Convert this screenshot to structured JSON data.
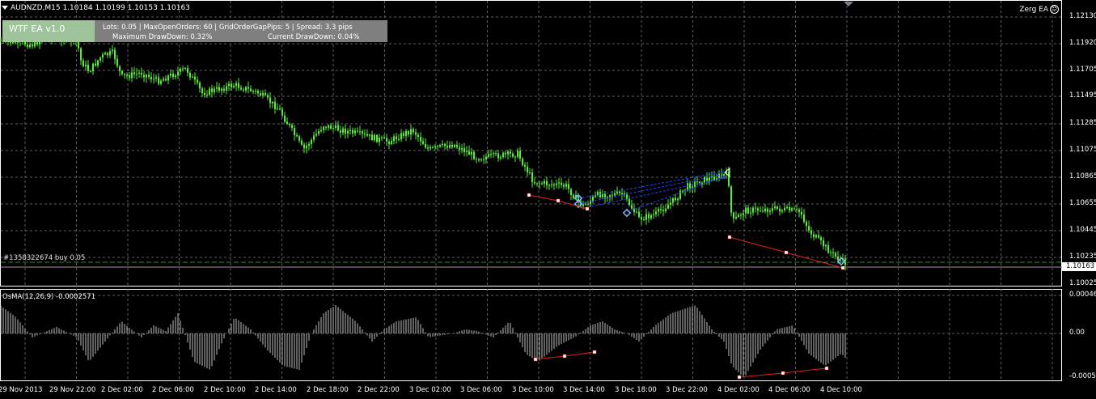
{
  "symbol_header": "AUDNZD,M15  1.10184 1.10199 1.10153 1.10163",
  "ea_name": "Zerg EA",
  "ea_icon": "smiley-icon",
  "panel": {
    "title": "WTF EA v1.0",
    "row1": "Lots: 0.05    |    MaxOpenOrders: 60    |    GridOrderGapPips: 5    |    Spread: 3.3 pips",
    "max_drawdown": "Maximum DrawDown: 0.32%",
    "current_drawdown": "Current DrawDown: 0.04%"
  },
  "order_label": "#1358322674 buy 0.05",
  "current_price_tag": "1.10163",
  "indicator_label": "OsMA(12,26,9) -0.0002571",
  "price_axis": [
    "1.12130",
    "1.11920",
    "1.11705",
    "1.11495",
    "1.11285",
    "1.11075",
    "1.10865",
    "1.10655",
    "1.10445",
    "1.10235",
    "1.10025"
  ],
  "osma_axis": [
    "0.000465",
    "0.00",
    "-0.00050"
  ],
  "time_axis": [
    "29 Nov 2013",
    "29 Nov 22:00",
    "2 Dec 02:00",
    "2 Dec 06:00",
    "2 Dec 10:00",
    "2 Dec 14:00",
    "2 Dec 18:00",
    "2 Dec 22:00",
    "3 Dec 02:00",
    "3 Dec 06:00",
    "3 Dec 10:00",
    "3 Dec 14:00",
    "3 Dec 18:00",
    "3 Dec 22:00",
    "4 Dec 02:00",
    "4 Dec 06:00",
    "4 Dec 10:00"
  ],
  "colors": {
    "background": "#000000",
    "candles": "#55ee33",
    "grid": "#606060",
    "histogram": "#c0c0c0",
    "divergence_line": "#e02020",
    "order_line": "#2a8a2a",
    "panel_bg": "#7f7f7f",
    "panel_title_bg": "#9fc39a"
  },
  "chart_data": {
    "type": "line",
    "title": "AUDNZD,M15",
    "series": [
      {
        "name": "AUDNZD",
        "x": [
          "29 Nov 2013",
          "29 Nov 22:00",
          "2 Dec 02:00",
          "2 Dec 06:00",
          "2 Dec 10:00",
          "2 Dec 14:00",
          "2 Dec 18:00",
          "2 Dec 22:00",
          "3 Dec 02:00",
          "3 Dec 06:00",
          "3 Dec 10:00",
          "3 Dec 14:00",
          "3 Dec 18:00",
          "3 Dec 22:00",
          "4 Dec 02:00",
          "4 Dec 06:00",
          "4 Dec 10:00"
        ],
        "values": [
          1.1194,
          1.1196,
          1.1178,
          1.1172,
          1.1158,
          1.1145,
          1.1123,
          1.112,
          1.1117,
          1.1108,
          1.1082,
          1.1072,
          1.106,
          1.109,
          1.106,
          1.1065,
          1.1016
        ]
      },
      {
        "name": "OsMA(12,26,9)",
        "x": [
          "29 Nov 2013",
          "29 Nov 22:00",
          "2 Dec 02:00",
          "2 Dec 06:00",
          "2 Dec 10:00",
          "2 Dec 14:00",
          "2 Dec 18:00",
          "2 Dec 22:00",
          "3 Dec 02:00",
          "3 Dec 06:00",
          "3 Dec 10:00",
          "3 Dec 14:00",
          "3 Dec 18:00",
          "3 Dec 22:00",
          "4 Dec 02:00",
          "4 Dec 06:00",
          "4 Dec 10:00"
        ],
        "values": [
          0.00035,
          8e-05,
          -0.0003,
          0.0001,
          -0.0003,
          0.0002,
          -0.00035,
          0.00015,
          -0.0002,
          0.0002,
          -0.00025,
          0.00015,
          -0.0002,
          0.00035,
          -0.0005,
          0.0001,
          -0.00026
        ]
      }
    ],
    "ylim": [
      1.1001,
      1.1223
    ]
  }
}
